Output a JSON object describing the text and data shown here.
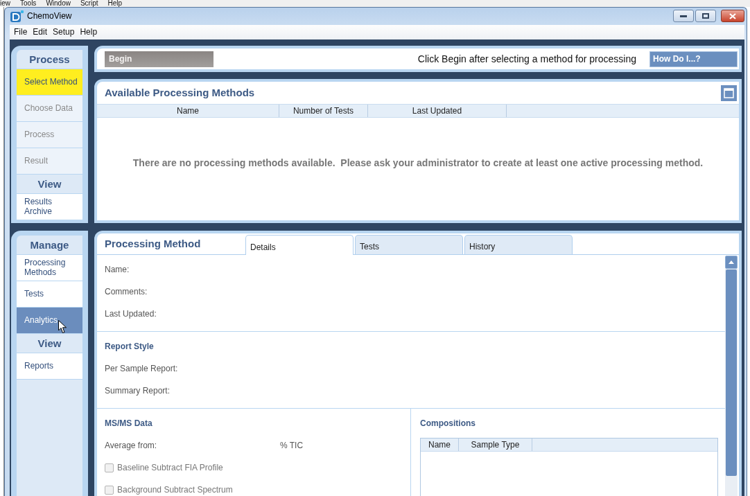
{
  "background_window": {
    "menu": [
      "iew",
      "Tools",
      "Window",
      "Script",
      "Help"
    ]
  },
  "window": {
    "title": "ChemoView"
  },
  "menu": [
    "File",
    "Edit",
    "Setup",
    "Help"
  ],
  "sidebar": [
    {
      "kind": "steps",
      "groups": [
        {
          "heading": "Process",
          "items": [
            {
              "label": "Select Method",
              "selected": true,
              "disabled": false
            },
            {
              "label": "Choose Data",
              "selected": false,
              "disabled": true
            },
            {
              "label": "Process",
              "selected": false,
              "disabled": true
            },
            {
              "label": "Result",
              "selected": false,
              "disabled": true
            }
          ]
        },
        {
          "heading": "View",
          "items": [
            {
              "label": "Results Archive",
              "selected": false,
              "disabled": false
            }
          ]
        }
      ]
    },
    {
      "kind": "nav",
      "groups": [
        {
          "heading": "Manage",
          "items": [
            {
              "label": "Processing Methods",
              "selected": false,
              "disabled": false
            },
            {
              "label": "Tests",
              "selected": false,
              "disabled": false
            },
            {
              "label": "Analytics",
              "selected": true,
              "disabled": false
            }
          ]
        },
        {
          "heading": "View",
          "items": [
            {
              "label": "Reports",
              "selected": false,
              "disabled": false
            }
          ]
        }
      ]
    }
  ],
  "action_bar": {
    "begin_button": {
      "label": "Begin",
      "disabled": true
    },
    "instruction": "Click Begin after selecting a method for processing",
    "help_button": "How Do I...?"
  },
  "methods": {
    "title": "Available Processing Methods",
    "columns": [
      "Name",
      "Number of Tests",
      "Last Updated"
    ],
    "empty_message": "There are no processing methods available.  Please ask your administrator to create at least one active processing method."
  },
  "processing_method": {
    "title": "Processing Method",
    "tabs": [
      {
        "label": "Details",
        "selected": true
      },
      {
        "label": "Tests",
        "selected": false
      },
      {
        "label": "History",
        "selected": false
      }
    ],
    "sections": [
      {
        "fields": [
          "Name:",
          "Comments:",
          "Last Updated:"
        ]
      },
      {
        "title": "Report Style",
        "fields": [
          "Per Sample Report:",
          "Summary Report:"
        ]
      }
    ],
    "msms_data": {
      "title": "MS/MS Data",
      "average_from": {
        "label": "Average from:",
        "unit": "% TIC"
      },
      "options": [
        {
          "label": "Baseline Subtract FIA Profile",
          "checked": false,
          "disabled": true
        },
        {
          "label": "Background Subtract Spectrum",
          "checked": false,
          "disabled": true
        }
      ]
    },
    "compositions": {
      "title": "Compositions",
      "columns": [
        "Name",
        "Sample Type"
      ]
    }
  }
}
